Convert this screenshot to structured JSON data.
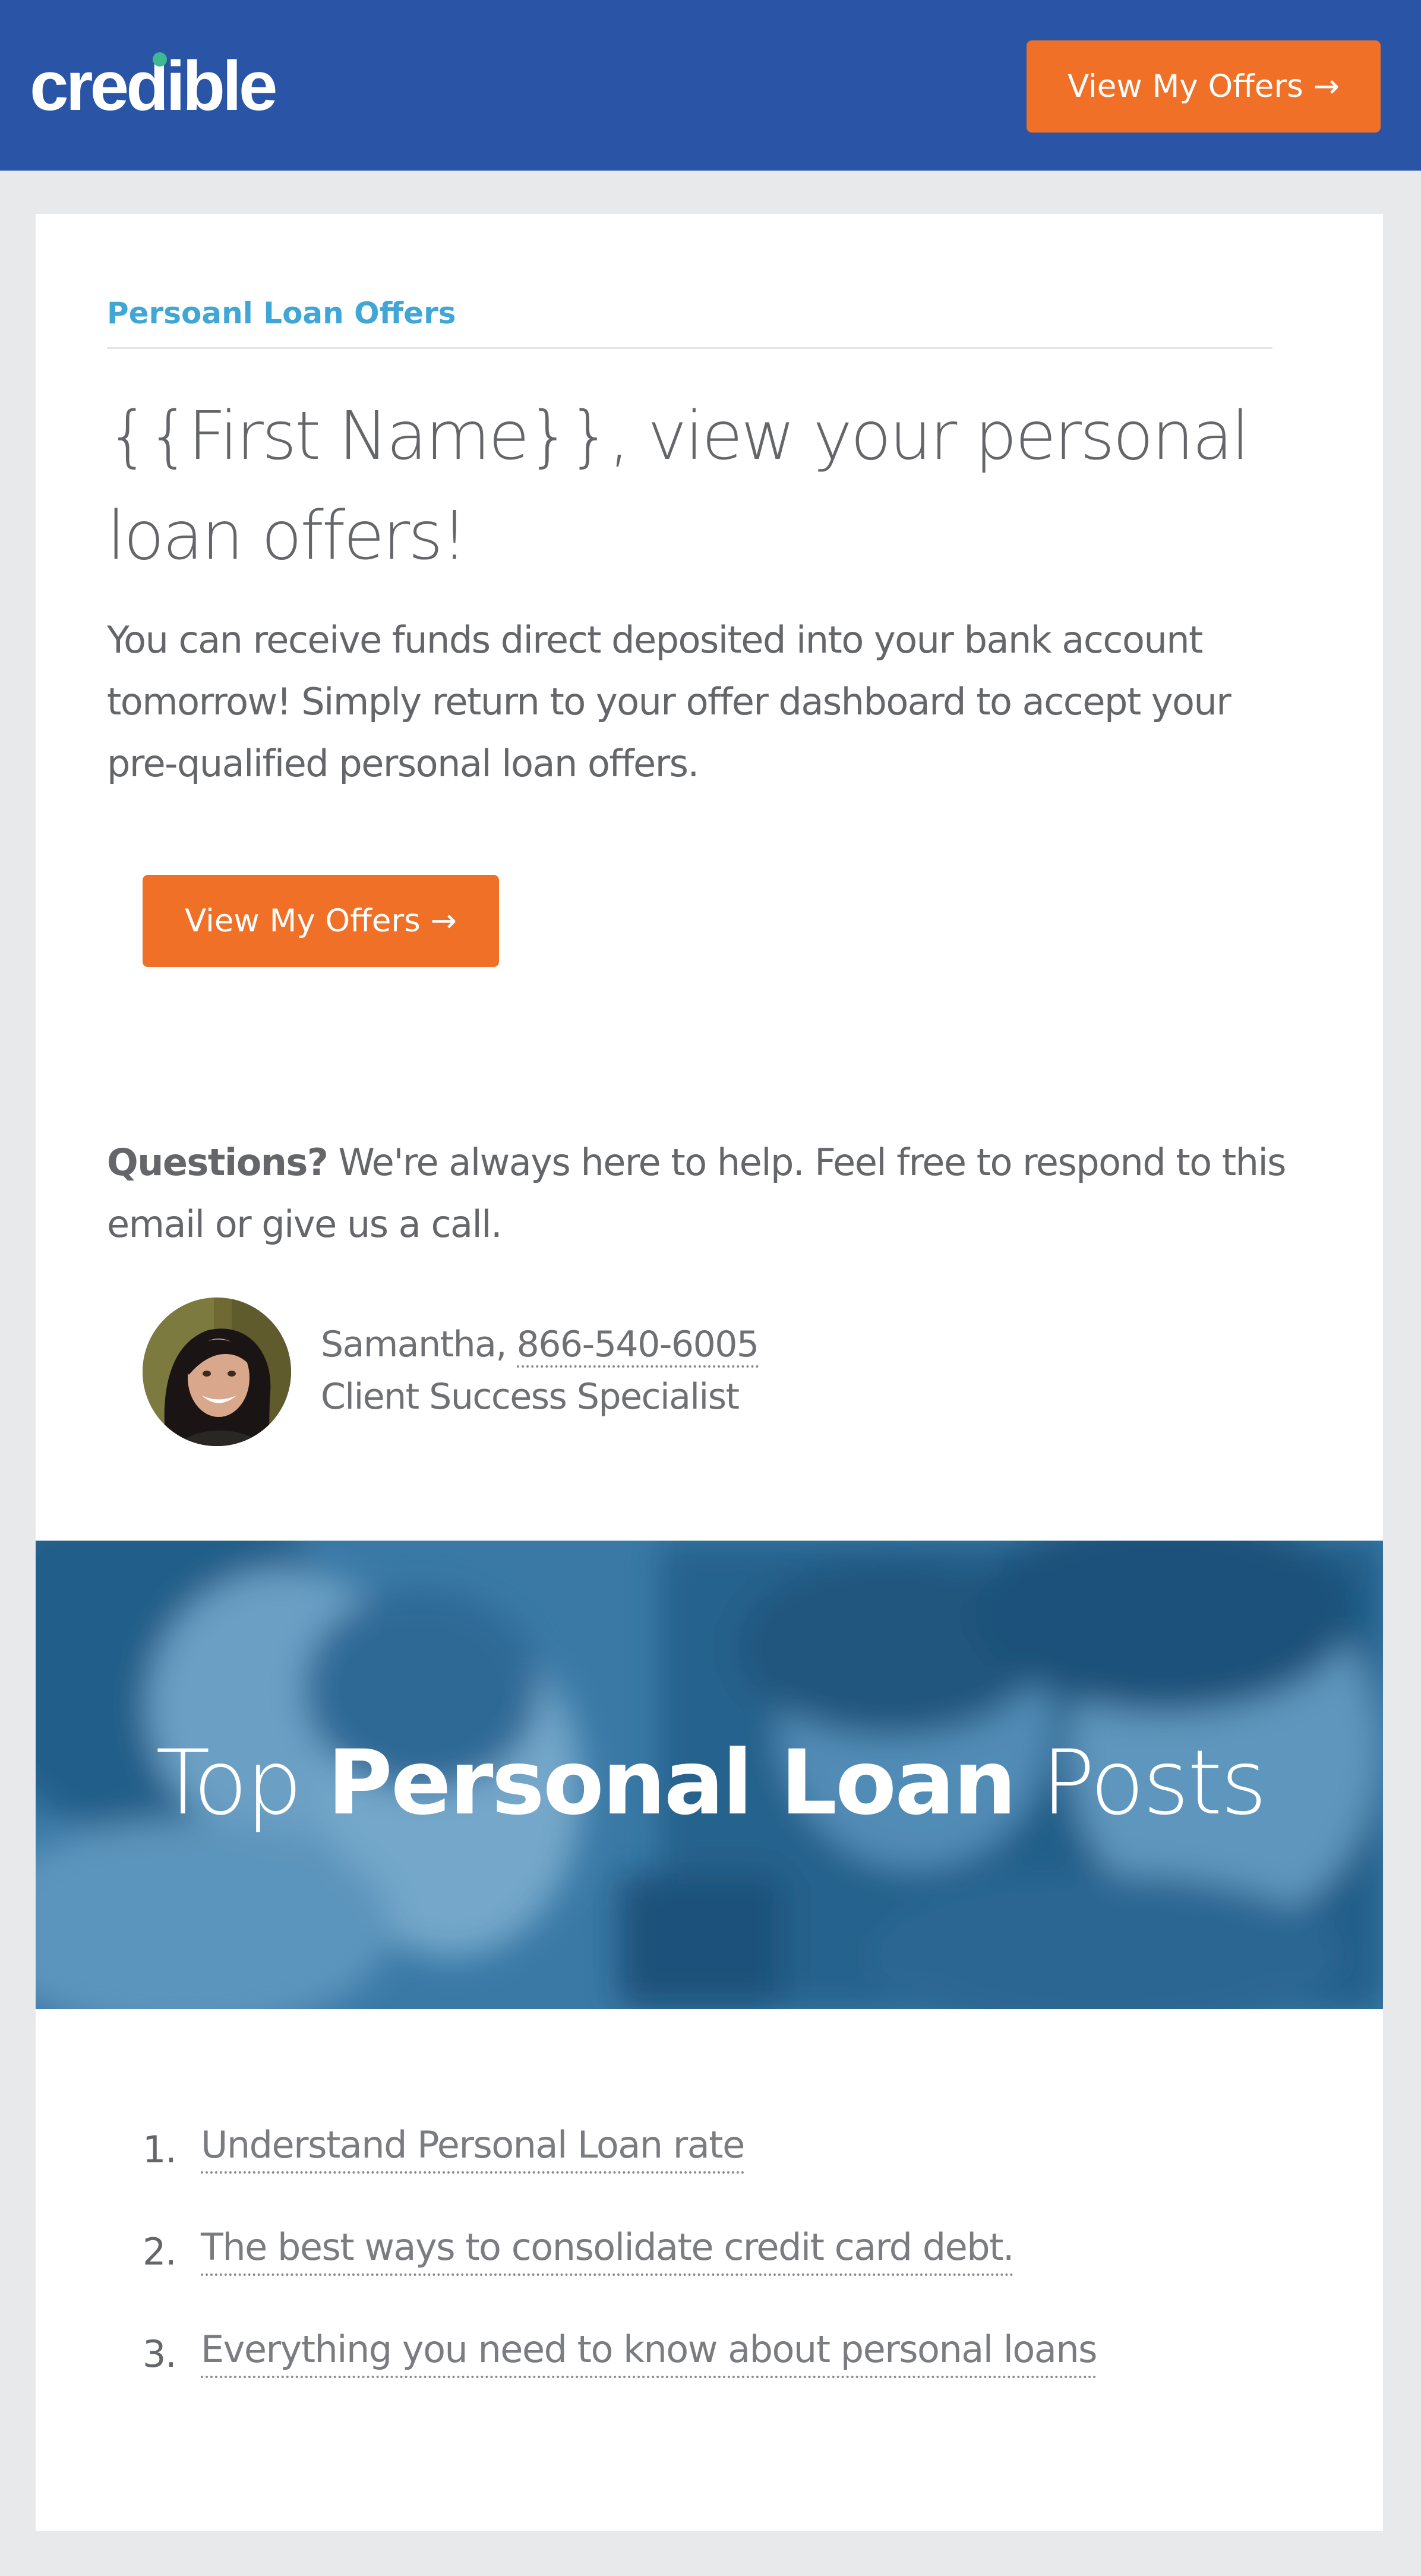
{
  "header": {
    "logo_text": "credible",
    "cta_label": "View My Offers →"
  },
  "content": {
    "eyebrow": "Persoanl Loan Offers",
    "headline": "{{First Name}}, view your personal loan offers!",
    "intro": "You can receive funds direct deposited into your bank account tomorrow! Simply return to your offer dashboard to accept your pre-qualified personal loan offers.",
    "cta_label": "View My Offers →",
    "questions_bold": "Questions?",
    "questions_text": " We're always here to help. Feel free to respond to this email or give us a call.",
    "contact": {
      "name": "Samantha, ",
      "phone": "866-540-6005",
      "role": "Client Success Specialist"
    }
  },
  "banner": {
    "title_pre": "Top ",
    "title_bold": "Personal Loan",
    "title_post": " Posts"
  },
  "posts": [
    {
      "num": "1.",
      "title": "Understand Personal Loan rate"
    },
    {
      "num": "2.",
      "title": "The best ways to consolidate credit card debt."
    },
    {
      "num": "3.",
      "title": "Everything you need to know about personal loans"
    }
  ],
  "colors": {
    "header_bg": "#2a54a6",
    "accent_orange": "#ef7026",
    "eyebrow_blue": "#3fa6d6",
    "page_bg": "#e8e9eb",
    "logo_dot": "#3fb98f"
  }
}
